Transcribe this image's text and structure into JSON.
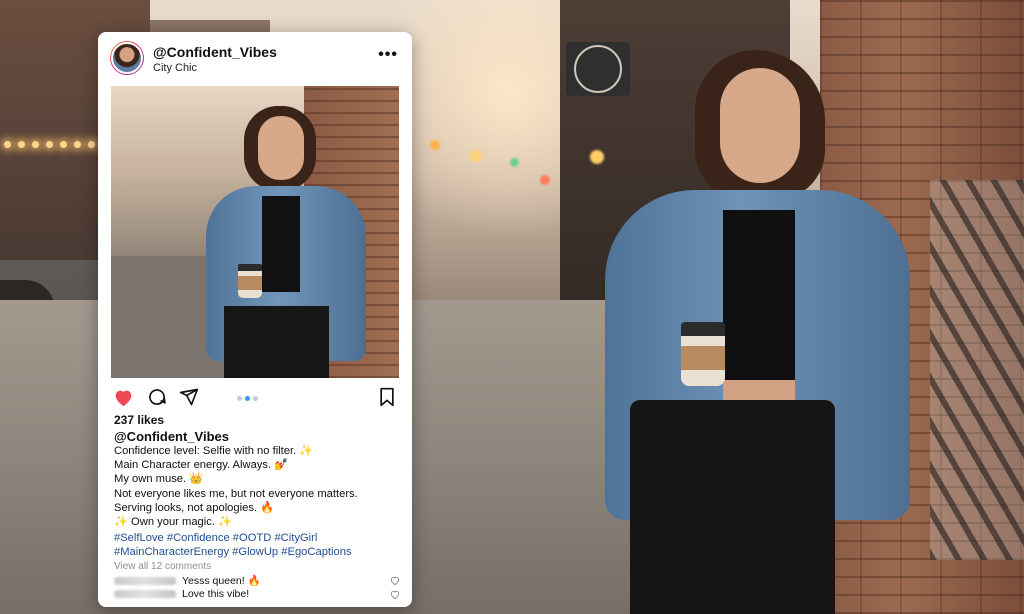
{
  "post": {
    "username": "@Confident_Vibes",
    "location": "City Chic",
    "more_icon": "more-options-icon",
    "likes": "237 likes",
    "caption_username": "@Confident_Vibes",
    "caption_lines": [
      "Confidence level: Selfie with no filter. ✨",
      "Main Character energy. Always. 💅",
      "My own muse. 👑",
      "Not everyone likes me, but not everyone matters.",
      "Serving looks, not apologies. 🔥",
      "✨ Own your magic. ✨"
    ],
    "hashtag_lines": [
      "#SelfLove #Confidence #OOTD #CityGirl",
      "#MainCharacterEnergy #GlowUp #EgoCaptions"
    ],
    "view_comments": "View all 12 comments",
    "comments": [
      {
        "text": "Yesss queen! 🔥"
      },
      {
        "text": "Love this vibe!"
      }
    ],
    "carousel": {
      "count": 3,
      "active_index": 1
    }
  },
  "icons": {
    "like": "heart-icon",
    "comment": "comment-icon",
    "share": "share-icon",
    "save": "bookmark-icon"
  },
  "colors": {
    "like_red": "#ed4956",
    "hashtag_blue": "#1f4f8f",
    "carousel_active": "#3897f0"
  }
}
